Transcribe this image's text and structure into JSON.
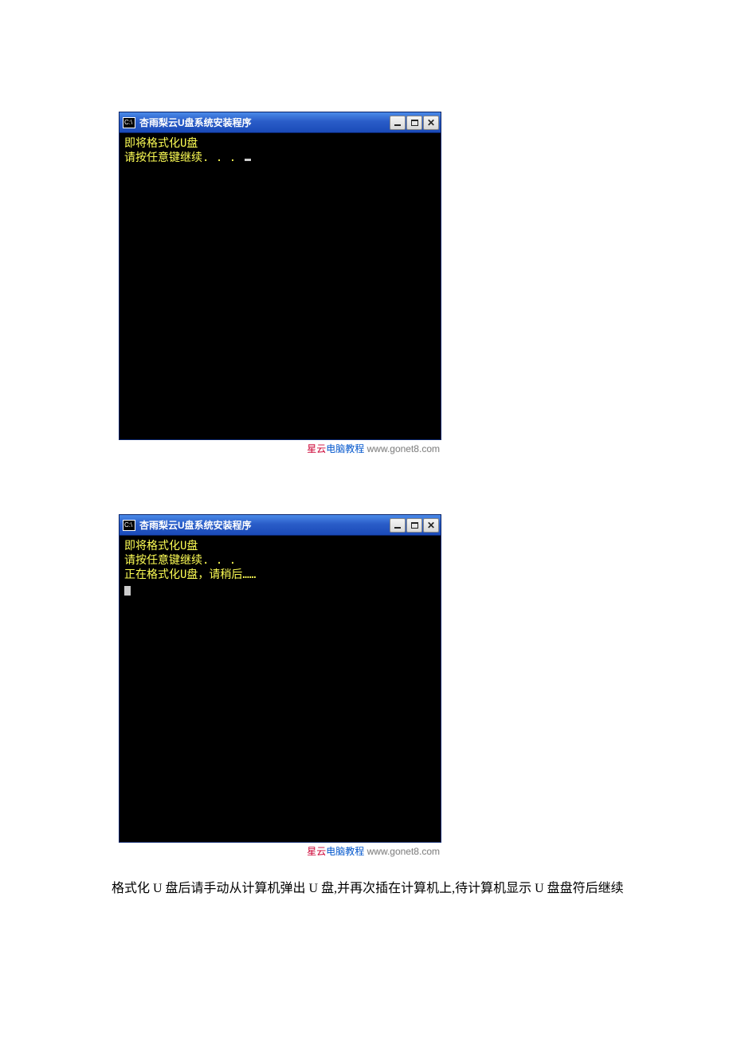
{
  "window1": {
    "icon_text": "C:\\",
    "title": "杏雨梨云U盘系统安装程序",
    "lines": [
      "即将格式化U盘",
      "请按任意键继续. . . "
    ]
  },
  "window2": {
    "icon_text": "C:\\",
    "title": "杏雨梨云U盘系统安装程序",
    "lines": [
      "即将格式化U盘",
      "请按任意键继续. . .",
      "正在格式化U盘，请稍后……"
    ]
  },
  "watermark": {
    "brand_red": "星云",
    "brand_blue": "电脑教程",
    "url": "www.gonet8.com"
  },
  "body_text": "格式化 U 盘后请手动从计算机弹出 U 盘,并再次插在计算机上,待计算机显示 U 盘盘符后继续"
}
